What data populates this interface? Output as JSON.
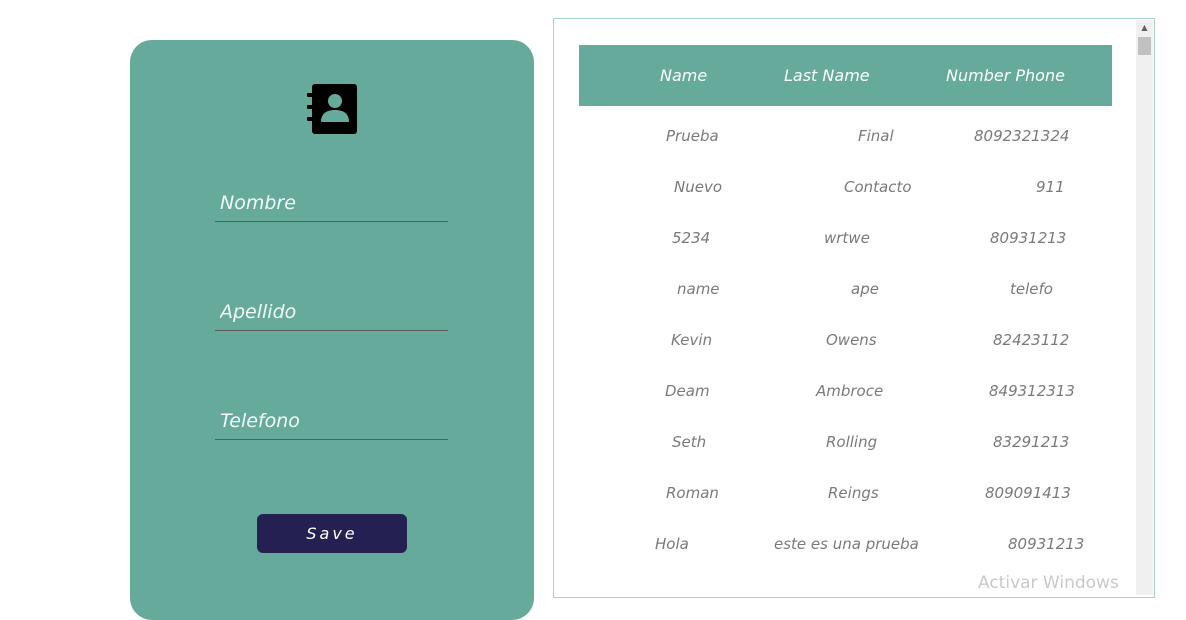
{
  "form": {
    "fields": [
      {
        "placeholder": "Nombre",
        "value": ""
      },
      {
        "placeholder": "Apellido",
        "value": ""
      },
      {
        "placeholder": "Telefono",
        "value": ""
      }
    ],
    "save_label": "Save",
    "colors": {
      "card": "#65aa9b",
      "button": "#242152"
    },
    "icon": "contact-book-icon"
  },
  "table": {
    "headers": [
      "Name",
      "Last Name",
      "Number Phone"
    ],
    "rows": [
      [
        "Prueba",
        "Final",
        "8092321324"
      ],
      [
        "Nuevo",
        "Contacto",
        "911"
      ],
      [
        "5234",
        "wrtwe",
        "80931213"
      ],
      [
        "name",
        "ape",
        "telefo"
      ],
      [
        "Kevin",
        "Owens",
        "82423112"
      ],
      [
        "Deam",
        "Ambroce",
        "849312313"
      ],
      [
        "Seth",
        "Rolling",
        "83291213"
      ],
      [
        "Roman",
        "Reings",
        "809091413"
      ],
      [
        "Hola",
        "este es una prueba",
        "80931213"
      ]
    ],
    "header_color": "#65aa9b"
  },
  "watermark": "Activar Windows"
}
